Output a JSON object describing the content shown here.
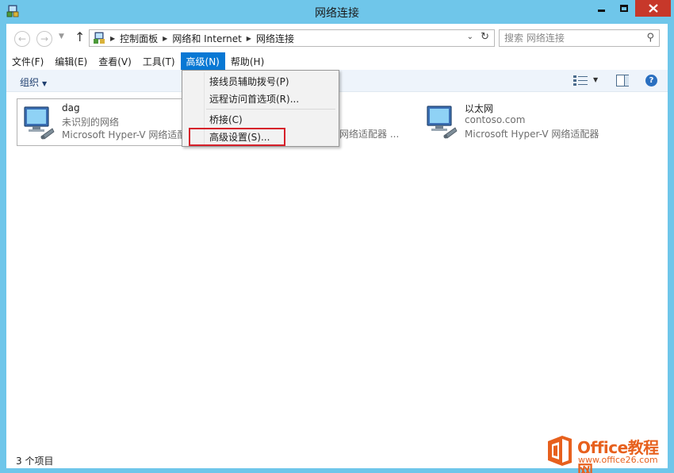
{
  "window": {
    "title": "网络连接"
  },
  "nav": {
    "back_label": "←",
    "forward_label": "→",
    "recent_label": "▼",
    "up_label": "↑",
    "breadcrumbs": [
      "控制面板",
      "网络和 Internet",
      "网络连接"
    ],
    "breadcrumb_sep": "▶",
    "dropdown_glyph": "⌄",
    "refresh_glyph": "↻",
    "search_placeholder": "搜索 网络连接",
    "search_glyph": "⚲"
  },
  "menubar": {
    "items": [
      "文件(F)",
      "编辑(E)",
      "查看(V)",
      "工具(T)",
      "高级(N)",
      "帮助(H)"
    ]
  },
  "commandbar": {
    "organize_label": "组织",
    "organize_caret": "▼",
    "views_caret": "▼",
    "help_glyph": "?"
  },
  "adapters": [
    {
      "name": "dag",
      "status": "未识别的网络",
      "device": "Microsoft Hyper-V 网络适配器"
    },
    {
      "name": "",
      "status": "",
      "device": "网络适配器 ..."
    },
    {
      "name": "以太网",
      "status": "contoso.com",
      "device": "Microsoft Hyper-V 网络适配器"
    }
  ],
  "advanced_menu": {
    "items": [
      "接线员辅助拨号(P)",
      "远程访问首选项(R)...",
      "桥接(C)",
      "高级设置(S)..."
    ]
  },
  "statusbar": {
    "item_count": "3 个项目"
  },
  "watermark": {
    "title": "Office教程网",
    "url": "www.office26.com"
  },
  "colors": {
    "titlebar": "#6fc6ea",
    "close_button": "#c7382a",
    "menu_active": "#0878d4",
    "highlight_border": "#d6202a",
    "watermark": "#e7601d"
  }
}
